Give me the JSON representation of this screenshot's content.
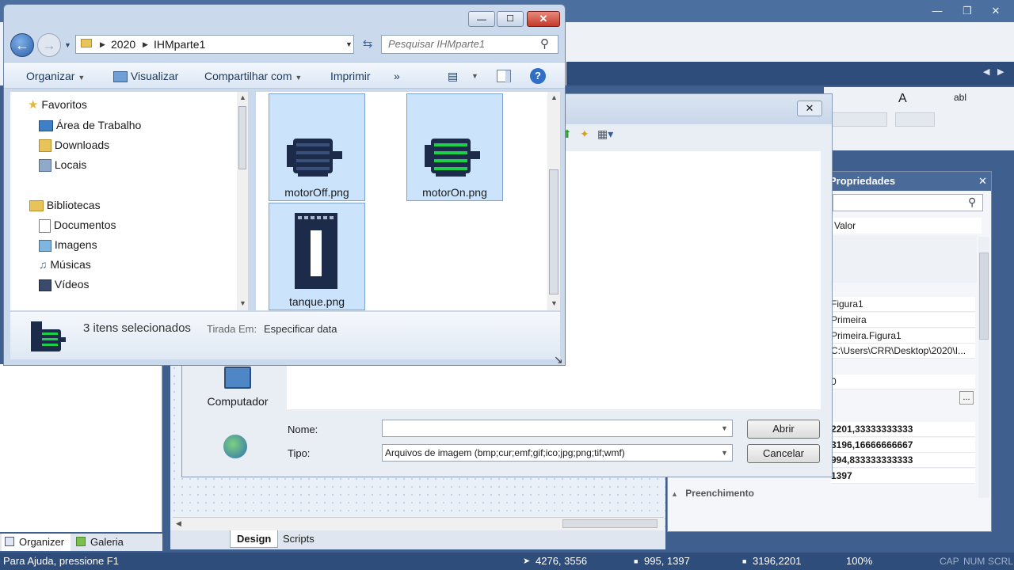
{
  "explorer": {
    "breadcrumb": [
      "2020",
      "IHMparte1"
    ],
    "search_placeholder": "Pesquisar IHMparte1",
    "toolbar": {
      "organize": "Organizar",
      "view": "Visualizar",
      "share": "Compartilhar com",
      "print": "Imprimir",
      "more": "»"
    },
    "nav": {
      "favorites_header": "Favoritos",
      "favorites": [
        "Área de Trabalho",
        "Downloads",
        "Locais"
      ],
      "libraries_header": "Bibliotecas",
      "libraries": [
        "Documentos",
        "Imagens",
        "Músicas",
        "Vídeos"
      ]
    },
    "files": [
      "motorOff.png",
      "motorOn.png",
      "tanque.png"
    ],
    "details": {
      "selected_count": "3 itens selecionados",
      "date_label": "Tirada Em:",
      "date_value": "Especificar data"
    }
  },
  "open_dialog": {
    "places": [
      "Computador"
    ],
    "name_label": "Nome:",
    "name_value": "",
    "type_label": "Tipo:",
    "type_value": "Arquivos de imagem (bmp;cur;emf;gif;ico;jpg;png;tif;wmf)",
    "open_button": "Abrir",
    "cancel_button": "Cancelar"
  },
  "properties": {
    "title": "Propriedades",
    "column_value": "Valor",
    "rows": [
      "Figura1",
      "Primeira",
      "Primeira.Figura1",
      "C:\\Users\\CRR\\Desktop\\2020\\I...",
      "0",
      "..."
    ],
    "bold_rows": [
      "2201,33333333333",
      "3196,16666666667",
      "994,833333333333",
      "1397"
    ],
    "section": "Preenchimento"
  },
  "bottom_tabs": {
    "design": "Design",
    "scripts": "Scripts"
  },
  "left_tabs": {
    "organizer": "Organizer",
    "gallery": "Galeria"
  },
  "status": {
    "help": "Para Ajuda, pressione F1",
    "pos1": "4276, 3556",
    "pos2": "995, 1397",
    "pos3": "3196,2201",
    "zoom": "100%",
    "cap": "CAP",
    "num": "NUM",
    "scrl": "SCRL"
  },
  "colors": {
    "accent": "#4a6a9a",
    "status_bar": "#2f4d7a",
    "selection": "#cce4fb",
    "motor_on": "#1ecf4a",
    "icon_navy": "#1c2b4a"
  }
}
